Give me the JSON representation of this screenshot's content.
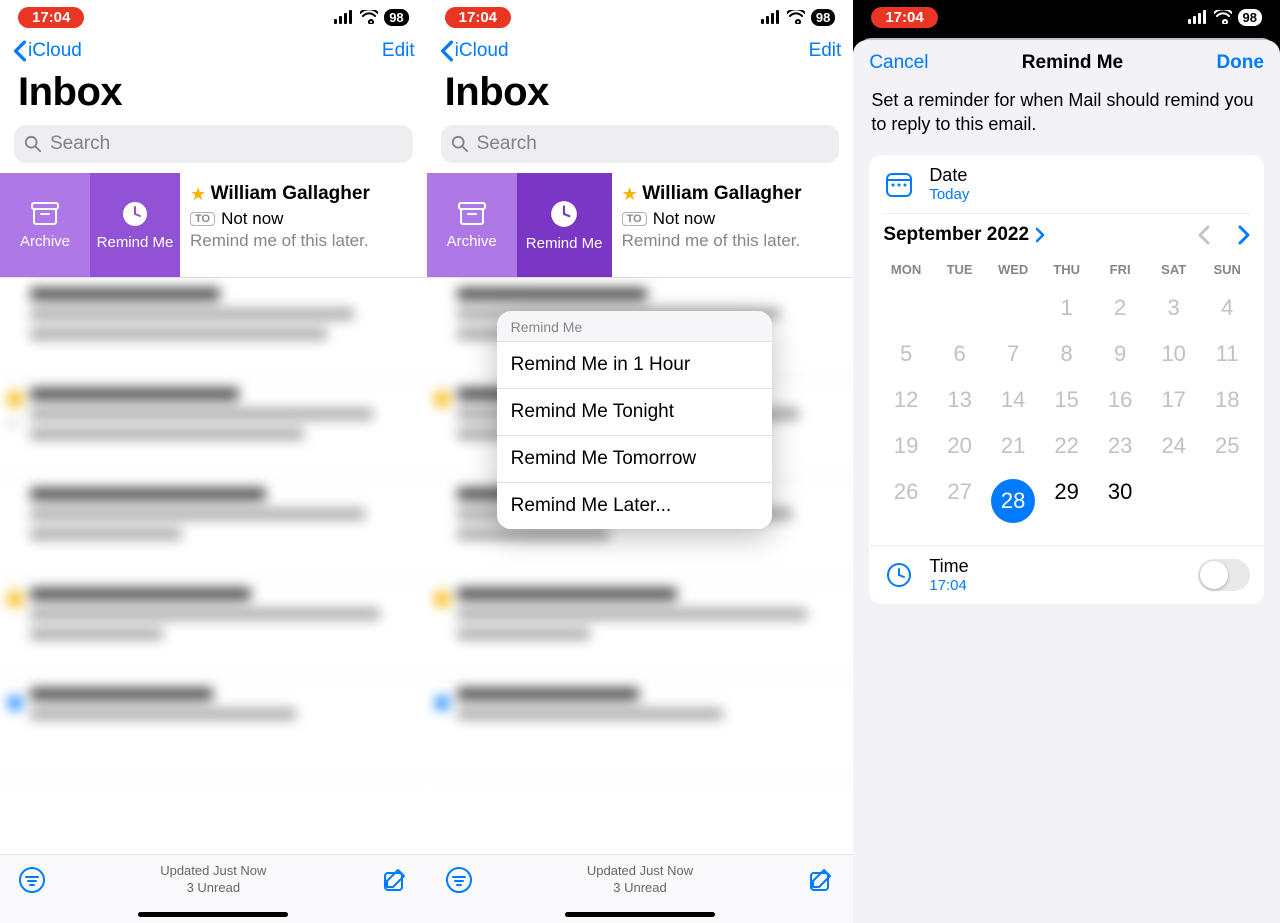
{
  "status": {
    "time": "17:04",
    "battery": "98"
  },
  "nav": {
    "back": "iCloud",
    "edit": "Edit",
    "title": "Inbox"
  },
  "search": {
    "placeholder": "Search"
  },
  "swipe": {
    "archive": "Archive",
    "remind": "Remind Me"
  },
  "message": {
    "sender": "William Gallagher",
    "to_badge": "TO",
    "subject": "Not now",
    "preview": "Remind me of this later."
  },
  "menu": {
    "header": "Remind Me",
    "items": [
      "Remind Me in 1 Hour",
      "Remind Me Tonight",
      "Remind Me Tomorrow",
      "Remind Me Later..."
    ]
  },
  "footer": {
    "updated": "Updated Just Now",
    "unread": "3 Unread"
  },
  "sheet": {
    "cancel": "Cancel",
    "title": "Remind Me",
    "done": "Done",
    "description": "Set a reminder for when Mail should remind you to reply to this email.",
    "date_label": "Date",
    "date_value": "Today",
    "month": "September 2022",
    "dow": [
      "MON",
      "TUE",
      "WED",
      "THU",
      "FRI",
      "SAT",
      "SUN"
    ],
    "weeks": [
      [
        "",
        "",
        "",
        "1",
        "2",
        "3",
        "4"
      ],
      [
        "5",
        "6",
        "7",
        "8",
        "9",
        "10",
        "11"
      ],
      [
        "12",
        "13",
        "14",
        "15",
        "16",
        "17",
        "18"
      ],
      [
        "19",
        "20",
        "21",
        "22",
        "23",
        "24",
        "25"
      ],
      [
        "26",
        "27",
        "28",
        "29",
        "30",
        "",
        ""
      ]
    ],
    "selected_day": "28",
    "current_after": [
      "29",
      "30"
    ],
    "time_label": "Time",
    "time_value": "17:04"
  }
}
